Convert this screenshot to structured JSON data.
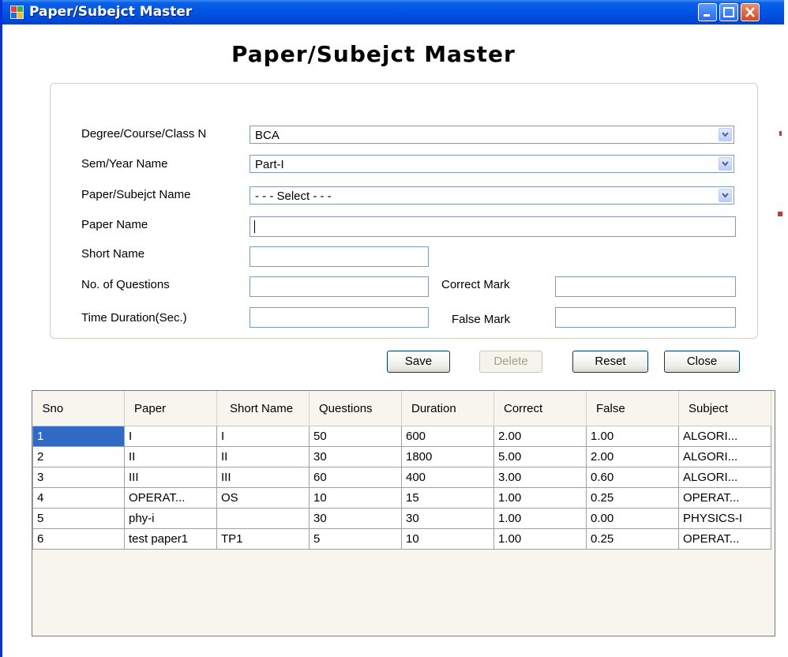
{
  "window": {
    "title": "Paper/Subejct Master"
  },
  "heading": "Paper/Subejct Master",
  "form": {
    "degree_label": "Degree/Course/Class N",
    "degree_value": "BCA",
    "sem_label": "Sem/Year Name",
    "sem_value": "Part-I",
    "subject_label": "Paper/Subejct Name",
    "subject_value": "- - - Select - - -",
    "paper_name_label": "Paper Name",
    "paper_name_value": "",
    "short_name_label": "Short Name",
    "questions_label": "No. of Questions",
    "correct_mark_label": "Correct Mark",
    "duration_label": "Time Duration(Sec.)",
    "false_mark_label": "False Mark"
  },
  "buttons": {
    "save": "Save",
    "delete": "Delete",
    "reset": "Reset",
    "close": "Close"
  },
  "table": {
    "columns": [
      "Sno",
      "Paper",
      "Short Name",
      "Questions",
      "Duration",
      "Correct",
      "False",
      "Subject"
    ],
    "rows": [
      [
        "1",
        "I",
        "I",
        "50",
        "600",
        "2.00",
        "1.00",
        "ALGORI..."
      ],
      [
        "2",
        "II",
        "II",
        "30",
        "1800",
        "5.00",
        "2.00",
        "ALGORI..."
      ],
      [
        "3",
        "III",
        "III",
        "60",
        "400",
        "3.00",
        "0.60",
        "ALGORI..."
      ],
      [
        "4",
        "OPERAT...",
        "OS",
        "10",
        "15",
        "1.00",
        "0.25",
        "OPERAT..."
      ],
      [
        "5",
        "phy-i",
        "",
        "30",
        "30",
        "1.00",
        "0.00",
        "PHYSICS-I"
      ],
      [
        "6",
        "test paper1",
        "TP1",
        "5",
        "10",
        "1.00",
        "0.25",
        "OPERAT..."
      ]
    ]
  }
}
